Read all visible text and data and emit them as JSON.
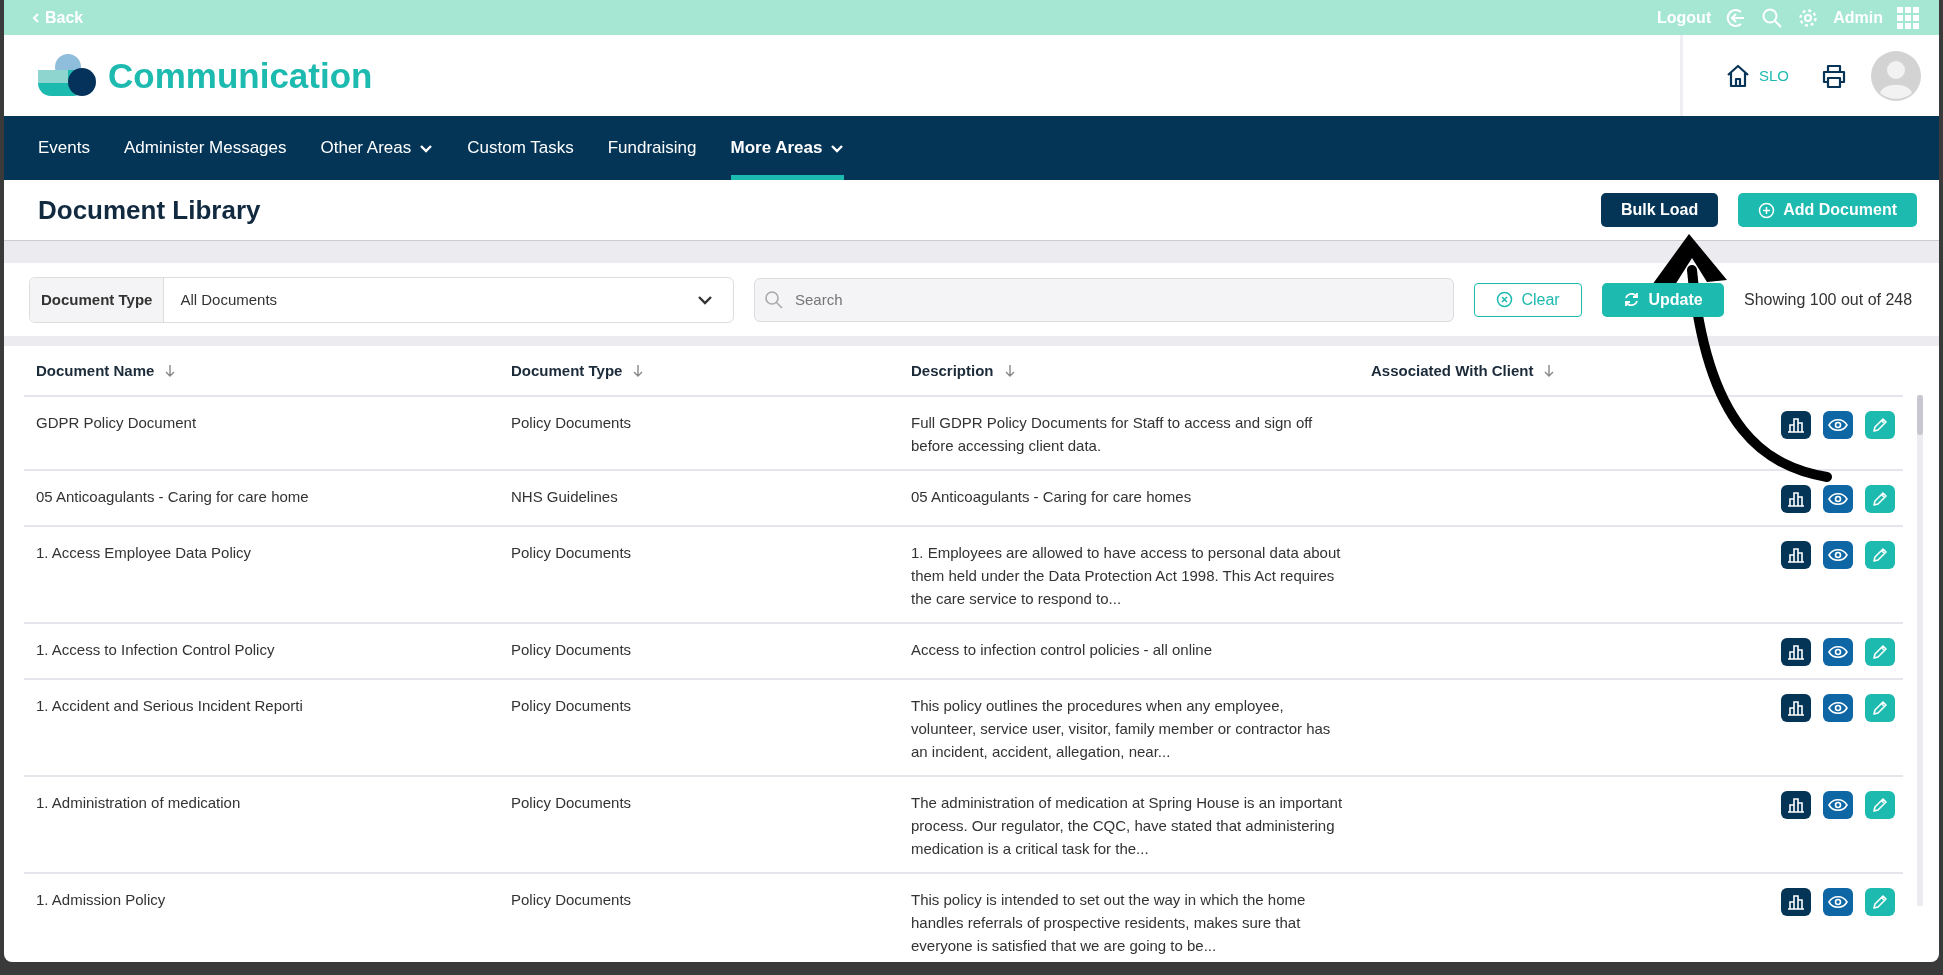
{
  "top_bar": {
    "back": "Back",
    "logout": "Logout",
    "user": "Admin"
  },
  "header": {
    "title": "Communication",
    "site": "SLO"
  },
  "nav": [
    {
      "label": "Events",
      "dropdown": false,
      "selected": false
    },
    {
      "label": "Administer Messages",
      "dropdown": false,
      "selected": false
    },
    {
      "label": "Other Areas",
      "dropdown": true,
      "selected": false
    },
    {
      "label": "Custom Tasks",
      "dropdown": false,
      "selected": false
    },
    {
      "label": "Fundraising",
      "dropdown": false,
      "selected": false
    },
    {
      "label": "More Areas",
      "dropdown": true,
      "selected": true
    }
  ],
  "page": {
    "title": "Document Library",
    "buttons": [
      {
        "label": "Bulk Load",
        "kind": "dark"
      },
      {
        "label": "Add Document",
        "kind": "add"
      }
    ]
  },
  "filters": {
    "type_label": "Document Type",
    "type_value": "All Documents",
    "search_placeholder": "Search",
    "clear": "Clear",
    "update": "Update",
    "count": "Showing 100 out of 248"
  },
  "table": {
    "columns": [
      "Document Name",
      "Document Type",
      "Description",
      "Associated With Client"
    ],
    "rows": [
      {
        "name": "GDPR Policy Document",
        "type": "Policy Documents",
        "description": "Full GDPR Policy Documents for Staff to access and sign off before accessing client data."
      },
      {
        "name": "05 Anticoagulants - Caring for care home",
        "type": "NHS Guidelines",
        "description": "05 Anticoagulants - Caring for care homes"
      },
      {
        "name": "1. Access Employee Data Policy",
        "type": "Policy Documents",
        "description": "1. Employees are allowed to have access to personal data about them held under the Data Protection Act 1998. This Act requires the care service to respond to..."
      },
      {
        "name": "1. Access to Infection Control Policy",
        "type": "Policy Documents",
        "description": "Access to infection control policies - all online"
      },
      {
        "name": "1. Accident and Serious Incident Reporti",
        "type": "Policy Documents",
        "description": "This policy outlines the procedures when any employee, volunteer, service user, visitor, family member or contractor has an incident, accident, allegation, near..."
      },
      {
        "name": "1. Administration of medication",
        "type": "Policy Documents",
        "description": "The administration of medication at Spring House is an important process. Our regulator, the CQC, have stated that administering medication is a critical task for the..."
      },
      {
        "name": "1. Admission Policy",
        "type": "Policy Documents",
        "description": "This policy is intended to set out the way in which the home handles referrals of prospective residents, makes sure that everyone is satisfied that we are going to be..."
      }
    ]
  }
}
